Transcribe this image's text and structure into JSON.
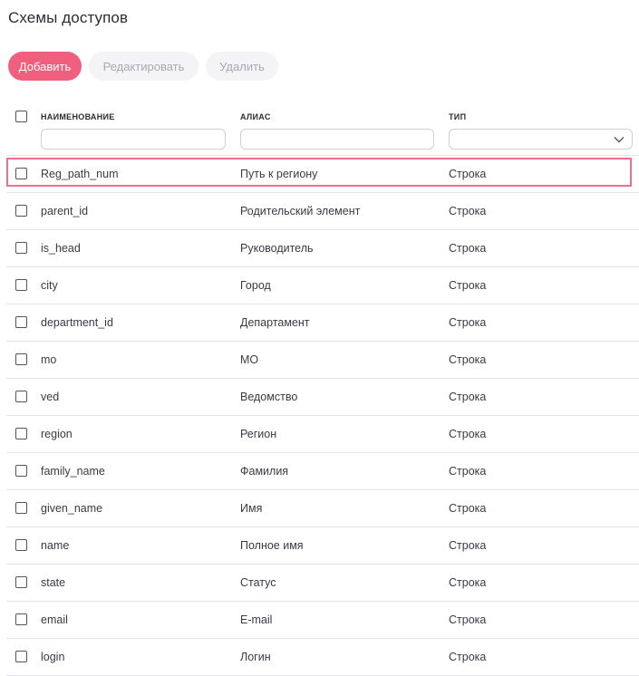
{
  "page": {
    "title": "Схемы доступов"
  },
  "toolbar": {
    "add_label": "Добавить",
    "edit_label": "Редактировать",
    "delete_label": "Удалить"
  },
  "table": {
    "columns": {
      "name": "НАИМЕНОВАНИЕ",
      "alias": "АЛИАС",
      "type": "ТИП"
    },
    "filters": {
      "name": "",
      "alias": "",
      "type": ""
    },
    "rows": [
      {
        "name": "Reg_path_num",
        "alias": "Путь к региону",
        "type": "Строка",
        "selected": true
      },
      {
        "name": "parent_id",
        "alias": "Родительский элемент",
        "type": "Строка"
      },
      {
        "name": "is_head",
        "alias": "Руководитель",
        "type": "Строка"
      },
      {
        "name": "city",
        "alias": "Город",
        "type": "Строка"
      },
      {
        "name": "department_id",
        "alias": "Департамент",
        "type": "Строка"
      },
      {
        "name": "mo",
        "alias": "МО",
        "type": "Строка"
      },
      {
        "name": "ved",
        "alias": "Ведомство",
        "type": "Строка"
      },
      {
        "name": "region",
        "alias": "Регион",
        "type": "Строка"
      },
      {
        "name": "family_name",
        "alias": "Фамилия",
        "type": "Строка"
      },
      {
        "name": "given_name",
        "alias": "Имя",
        "type": "Строка"
      },
      {
        "name": "name",
        "alias": "Полное имя",
        "type": "Строка"
      },
      {
        "name": "state",
        "alias": "Статус",
        "type": "Строка"
      },
      {
        "name": "email",
        "alias": "E-mail",
        "type": "Строка"
      },
      {
        "name": "login",
        "alias": "Логин",
        "type": "Строка"
      }
    ]
  },
  "colors": {
    "accent": "#f0607e",
    "selection_border": "#e9728f",
    "disabled_bg": "#f4f4f6"
  }
}
